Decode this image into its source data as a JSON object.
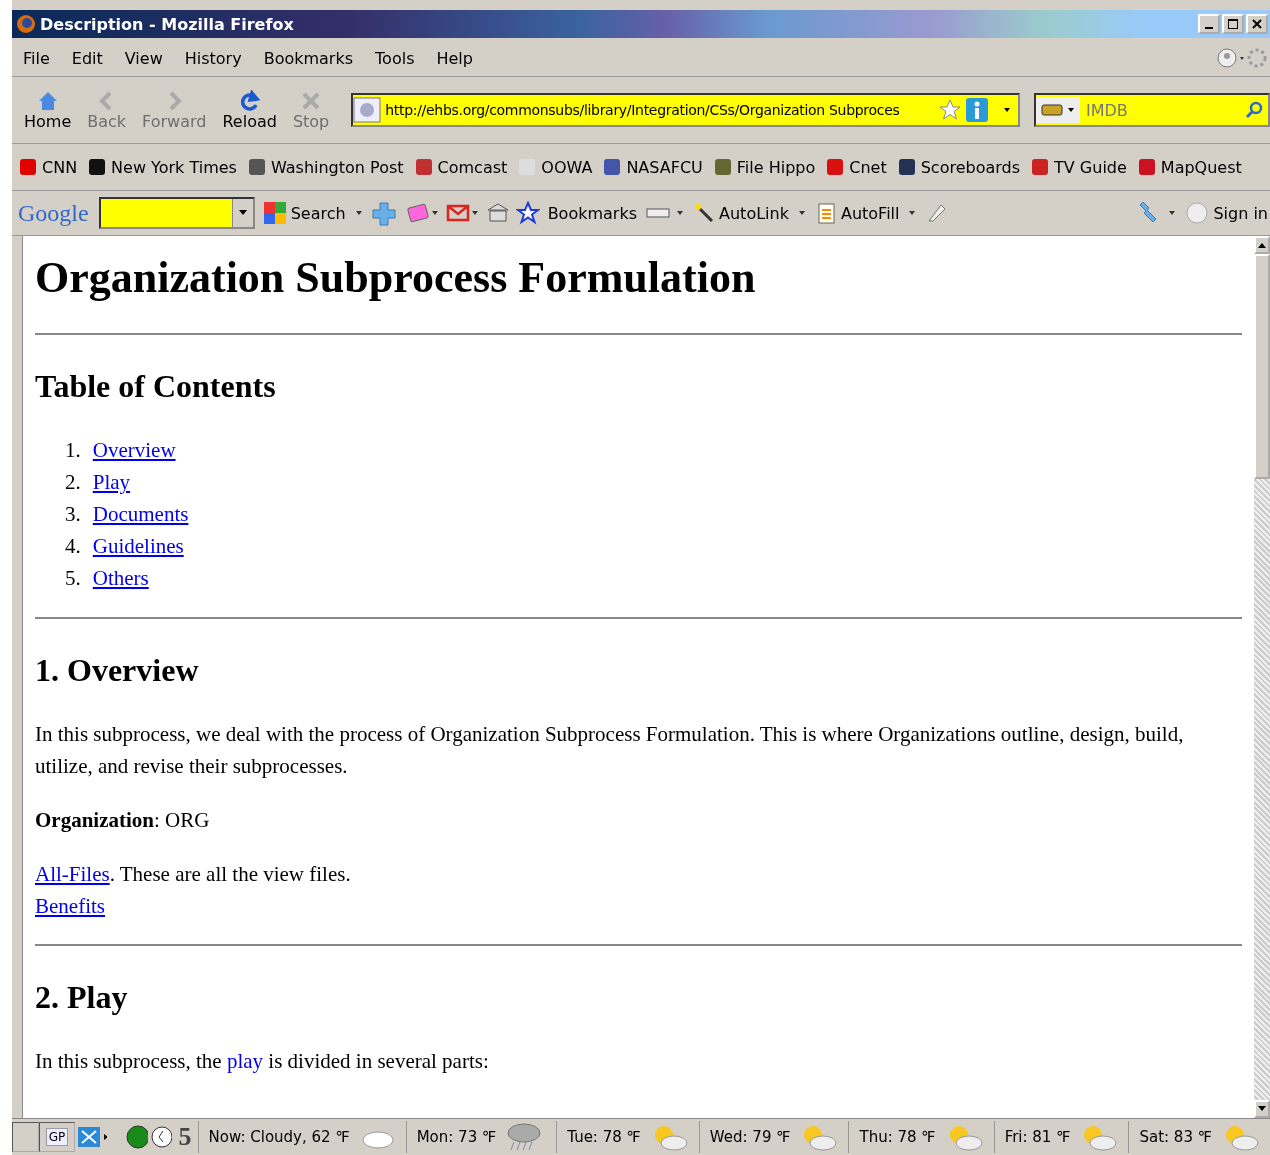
{
  "window": {
    "title": "Description - Mozilla Firefox"
  },
  "menu": [
    "File",
    "Edit",
    "View",
    "History",
    "Bookmarks",
    "Tools",
    "Help"
  ],
  "nav_buttons": [
    {
      "label": "Home",
      "disabled": false
    },
    {
      "label": "Back",
      "disabled": true
    },
    {
      "label": "Forward",
      "disabled": true
    },
    {
      "label": "Reload",
      "disabled": false
    },
    {
      "label": "Stop",
      "disabled": true
    }
  ],
  "address": {
    "value": "http://ehbs.org/commonsubs/library/Integration/CSs/Organization Subproces"
  },
  "search": {
    "placeholder": "IMDB"
  },
  "bookmarks": [
    "CNN",
    "New York Times",
    "Washington Post",
    "Comcast",
    "OOWA",
    "NASAFCU",
    "File Hippo",
    "Cnet",
    "Scoreboards",
    "TV Guide",
    "MapQuest"
  ],
  "google_toolbar": {
    "logo": "Google",
    "search": "Search",
    "bookmarks": "Bookmarks",
    "autolink": "AutoLink",
    "autofill": "AutoFill",
    "sign_in": "Sign in"
  },
  "page": {
    "title": "Organization Subprocess Formulation",
    "toc_heading": "Table of Contents",
    "toc": [
      {
        "number": "1.",
        "label": "Overview"
      },
      {
        "number": "2.",
        "label": "Play"
      },
      {
        "number": "3.",
        "label": "Documents"
      },
      {
        "number": "4.",
        "label": "Guidelines"
      },
      {
        "number": "5.",
        "label": "Others"
      }
    ],
    "overview": {
      "heading": "1. Overview",
      "paragraph": "In this subprocess, we deal with the process of Organization Subprocess Formulation. This is where Organizations outline, design, build, utilize, and revise their subprocesses.",
      "org_line": "**Organization**: ORG",
      "files_link": "All-Files",
      "files_text": ". These are all the view files.",
      "benefits_link": "Benefits"
    },
    "play": {
      "heading": "2. Play",
      "before": "In this subprocess, the",
      "link": "play",
      "after": "is divided in several parts:"
    }
  },
  "status_bar": {
    "gp": "GP",
    "count": "5",
    "weather": [
      {
        "label": "Now: Cloudy, 62 ℉",
        "kind": "cloudy"
      },
      {
        "label": "Mon: 73 ℉",
        "kind": "rain"
      },
      {
        "label": "Tue: 78 ℉",
        "kind": "partly"
      },
      {
        "label": "Wed: 79 ℉",
        "kind": "partly"
      },
      {
        "label": "Thu: 78 ℉",
        "kind": "partly"
      },
      {
        "label": "Fri: 81 ℉",
        "kind": "partly"
      },
      {
        "label": "Sat: 83 ℉",
        "kind": "partly"
      }
    ]
  }
}
